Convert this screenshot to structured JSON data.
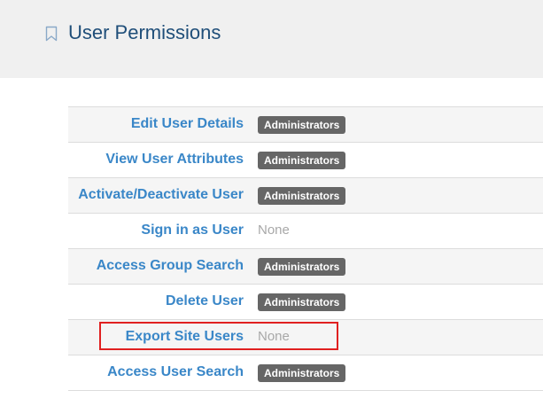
{
  "header": {
    "title": "User Permissions",
    "bookmark_icon": "bookmark-icon"
  },
  "permissions": [
    {
      "label": "Edit User Details",
      "value": "Administrators",
      "type": "badge"
    },
    {
      "label": "View User Attributes",
      "value": "Administrators",
      "type": "badge"
    },
    {
      "label": "Activate/Deactivate User",
      "value": "Administrators",
      "type": "badge"
    },
    {
      "label": "Sign in as User",
      "value": "None",
      "type": "none"
    },
    {
      "label": "Access Group Search",
      "value": "Administrators",
      "type": "badge"
    },
    {
      "label": "Delete User",
      "value": "Administrators",
      "type": "badge"
    },
    {
      "label": "Export Site Users",
      "value": "None",
      "type": "none"
    },
    {
      "label": "Access User Search",
      "value": "Administrators",
      "type": "badge"
    }
  ],
  "colors": {
    "title": "#1f4e79",
    "link": "#3a87c8",
    "badge_bg": "#666666",
    "none_text": "#a8a8a8",
    "highlight": "#e02020"
  }
}
